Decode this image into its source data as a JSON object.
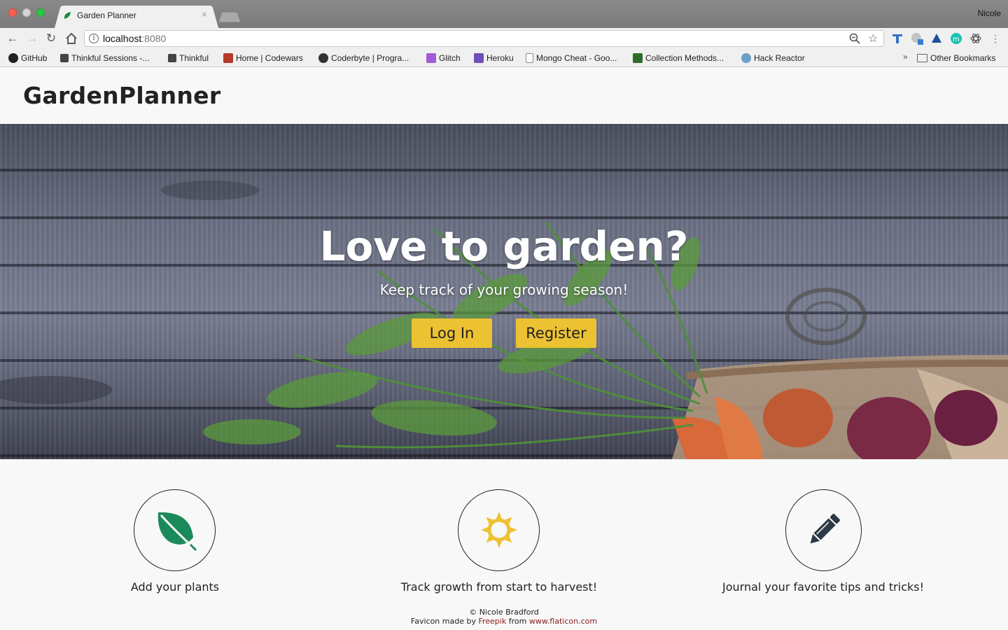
{
  "browser": {
    "tab_title": "Garden Planner",
    "tab_close": "×",
    "profile_name": "Nicole",
    "url_host": "localhost",
    "url_port": ":8080",
    "bookmarks": [
      {
        "label": "GitHub",
        "icon": "github-icon"
      },
      {
        "label": "Thinkful Sessions -...",
        "icon": "thinkful-icon"
      },
      {
        "label": "Thinkful",
        "icon": "thinkful-icon"
      },
      {
        "label": "Home | Codewars",
        "icon": "codewars-icon"
      },
      {
        "label": "Coderbyte | Progra...",
        "icon": "coderbyte-icon"
      },
      {
        "label": "Glitch",
        "icon": "glitch-icon"
      },
      {
        "label": "Heroku",
        "icon": "heroku-icon"
      },
      {
        "label": "Mongo Cheat - Goo...",
        "icon": "doc-icon"
      },
      {
        "label": "Collection Methods...",
        "icon": "mongodb-icon"
      },
      {
        "label": "Hack Reactor",
        "icon": "hackreactor-icon"
      }
    ],
    "bookmarks_overflow": "»",
    "other_bookmarks": "Other Bookmarks"
  },
  "header": {
    "brand": "GardenPlanner"
  },
  "hero": {
    "title": "Love to garden?",
    "subtitle": "Keep track of your growing season!",
    "login_label": "Log In",
    "register_label": "Register",
    "button_color": "#ecc232"
  },
  "features": [
    {
      "label": "Add your plants",
      "icon": "leaf-icon",
      "color": "#1b8a5a"
    },
    {
      "label": "Track growth from start to harvest!",
      "icon": "sun-icon",
      "color": "#ecc232"
    },
    {
      "label": "Journal your favorite tips and tricks!",
      "icon": "pencil-icon",
      "color": "#2d3a45"
    }
  ],
  "footer": {
    "copyright": "© Nicole Bradford",
    "favicon_prefix": "Favicon made by ",
    "favicon_author": "Freepik",
    "favicon_mid": " from ",
    "favicon_site": "www.flaticon.com"
  }
}
